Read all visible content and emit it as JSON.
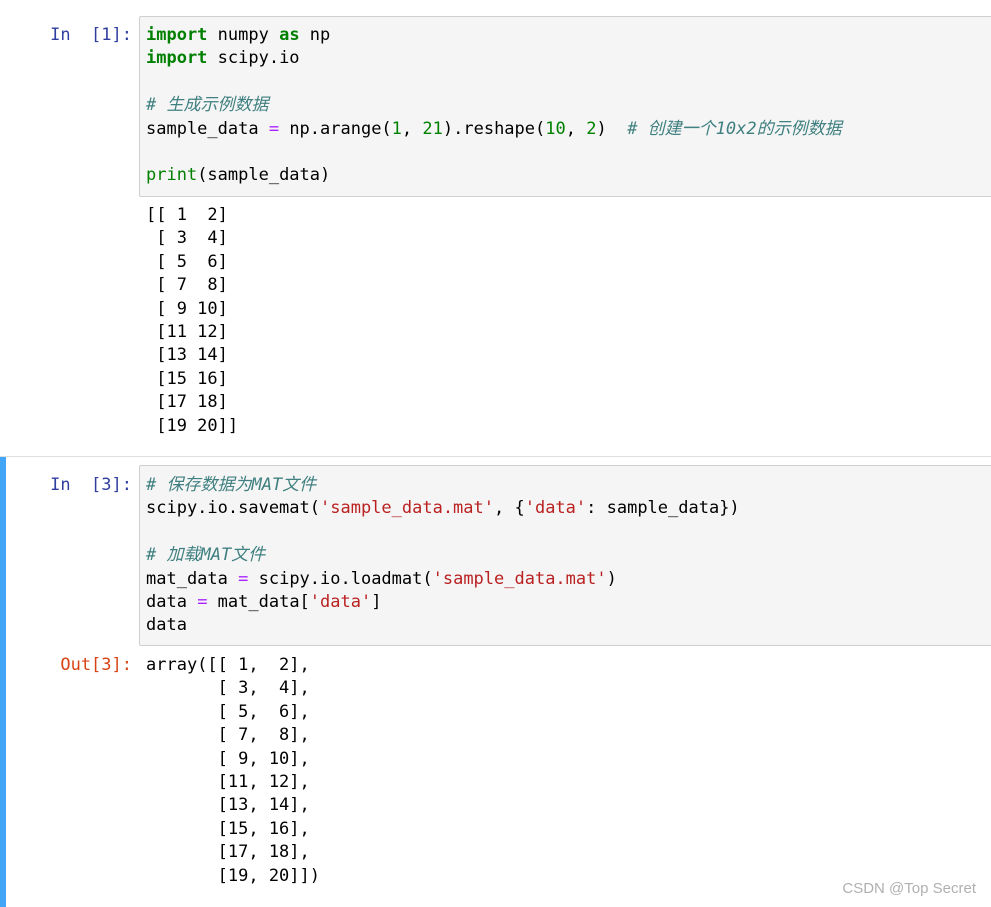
{
  "cells": [
    {
      "prompt": "In  [1]:",
      "code": [
        [
          [
            "kw",
            "import"
          ],
          [
            "",
            " numpy "
          ],
          [
            "kw",
            "as"
          ],
          [
            "",
            " np"
          ]
        ],
        [
          [
            "kw",
            "import"
          ],
          [
            "",
            " scipy.io"
          ]
        ],
        [],
        [
          [
            "cm",
            "# 生成示例数据"
          ]
        ],
        [
          [
            "",
            "sample_data "
          ],
          [
            "op",
            "="
          ],
          [
            "",
            " np.arange("
          ],
          [
            "num",
            "1"
          ],
          [
            "",
            ", "
          ],
          [
            "num",
            "21"
          ],
          [
            "",
            ").reshape("
          ],
          [
            "num",
            "10"
          ],
          [
            "",
            ", "
          ],
          [
            "num",
            "2"
          ],
          [
            "",
            ")  "
          ],
          [
            "cm",
            "# 创建一个10x2的示例数据"
          ]
        ],
        [],
        [
          [
            "bi",
            "print"
          ],
          [
            "",
            "(sample_data)"
          ]
        ]
      ],
      "output_lines": [
        "[[ 1  2]",
        " [ 3  4]",
        " [ 5  6]",
        " [ 7  8]",
        " [ 9 10]",
        " [11 12]",
        " [13 14]",
        " [15 16]",
        " [17 18]",
        " [19 20]]"
      ]
    },
    {
      "prompt": "In  [3]:",
      "code": [
        [
          [
            "cm",
            "# 保存数据为MAT文件"
          ]
        ],
        [
          [
            "",
            "scipy.io.savemat("
          ],
          [
            "str",
            "'sample_data.mat'"
          ],
          [
            "",
            ", {"
          ],
          [
            "str",
            "'data'"
          ],
          [
            "",
            ": sample_data})"
          ]
        ],
        [],
        [
          [
            "cm",
            "# 加载MAT文件"
          ]
        ],
        [
          [
            "",
            "mat_data "
          ],
          [
            "op",
            "="
          ],
          [
            "",
            " scipy.io.loadmat("
          ],
          [
            "str",
            "'sample_data.mat'"
          ],
          [
            "",
            ")"
          ]
        ],
        [
          [
            "",
            "data "
          ],
          [
            "op",
            "="
          ],
          [
            "",
            " mat_data["
          ],
          [
            "str",
            "'data'"
          ],
          [
            "",
            "]"
          ]
        ],
        [
          [
            "",
            "data"
          ]
        ]
      ],
      "out_prompt": "Out[3]:",
      "output_lines": [
        "array([[ 1,  2],",
        "       [ 3,  4],",
        "       [ 5,  6],",
        "       [ 7,  8],",
        "       [ 9, 10],",
        "       [11, 12],",
        "       [13, 14],",
        "       [15, 16],",
        "       [17, 18],",
        "       [19, 20]])"
      ]
    }
  ],
  "watermark": "CSDN @Top Secret",
  "colors": {
    "selection_bar": "#42a5f5",
    "in_prompt": "#303f9f",
    "out_prompt": "#d84315",
    "keyword": "#008000",
    "string": "#ba2121",
    "comment": "#408080",
    "operator": "#aa22ff"
  }
}
